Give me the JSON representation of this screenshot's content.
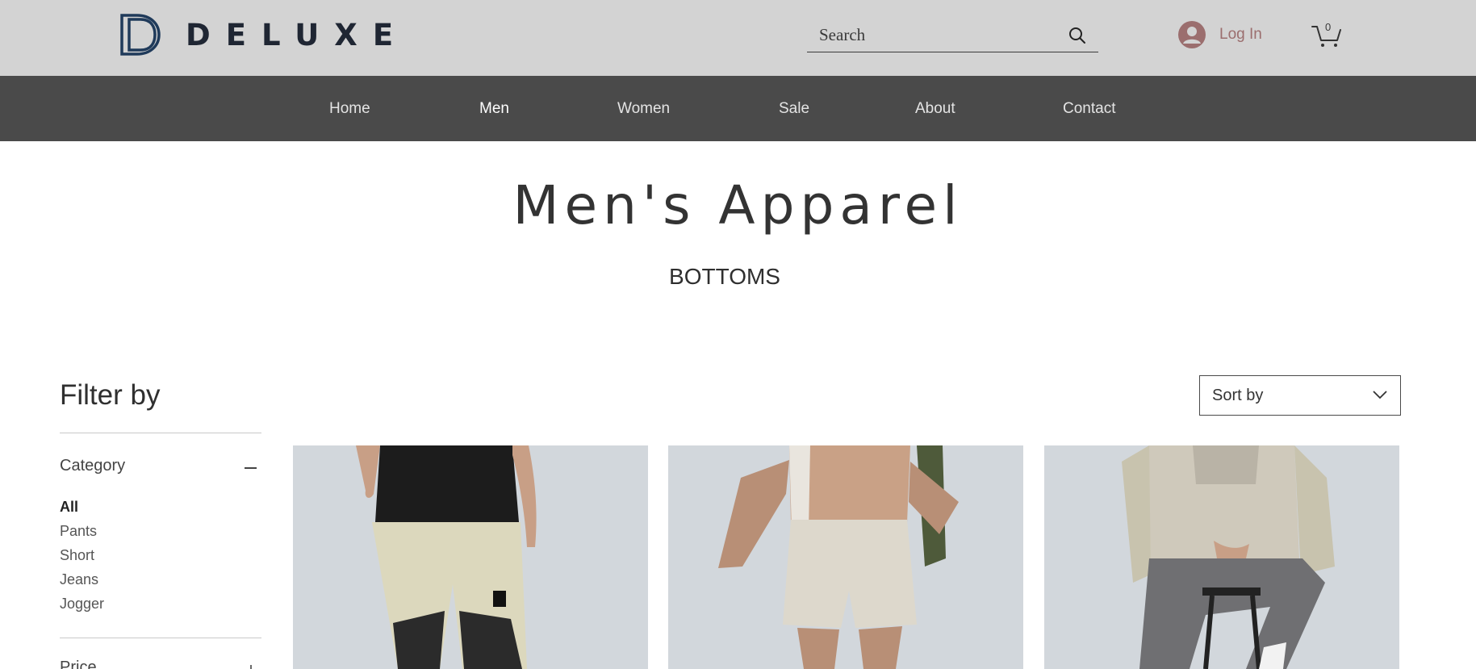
{
  "header": {
    "brand": "DELUXE",
    "logo_icon": "double-d-logo-icon",
    "search": {
      "placeholder": "Search",
      "icon": "search-icon"
    },
    "login": {
      "label": "Log In",
      "icon": "avatar-icon"
    },
    "cart": {
      "count": "0",
      "icon": "cart-icon"
    }
  },
  "nav": {
    "items": [
      {
        "label": "Home",
        "active": false
      },
      {
        "label": "Men",
        "active": true
      },
      {
        "label": "Women",
        "active": false
      },
      {
        "label": "Sale",
        "active": false
      },
      {
        "label": "About",
        "active": false
      },
      {
        "label": "Contact",
        "active": false
      }
    ]
  },
  "page": {
    "title": "Men's Apparel",
    "subtitle": "BOTTOMS"
  },
  "filter": {
    "title": "Filter by",
    "category": {
      "label": "Category",
      "items": [
        "All",
        "Pants",
        "Short",
        "Jeans",
        "Jogger"
      ],
      "selected": "All"
    },
    "price": {
      "label": "Price"
    }
  },
  "sort": {
    "label": "Sort by"
  },
  "products": [
    {
      "image": "pants-product-image"
    },
    {
      "image": "shorts-product-image"
    },
    {
      "image": "jeans-product-image"
    }
  ],
  "colors": {
    "header_bg": "#d3d3d3",
    "nav_bg": "#4a4a4a",
    "product_bg": "#d2d7dc",
    "login_text": "#9b6e6e"
  }
}
